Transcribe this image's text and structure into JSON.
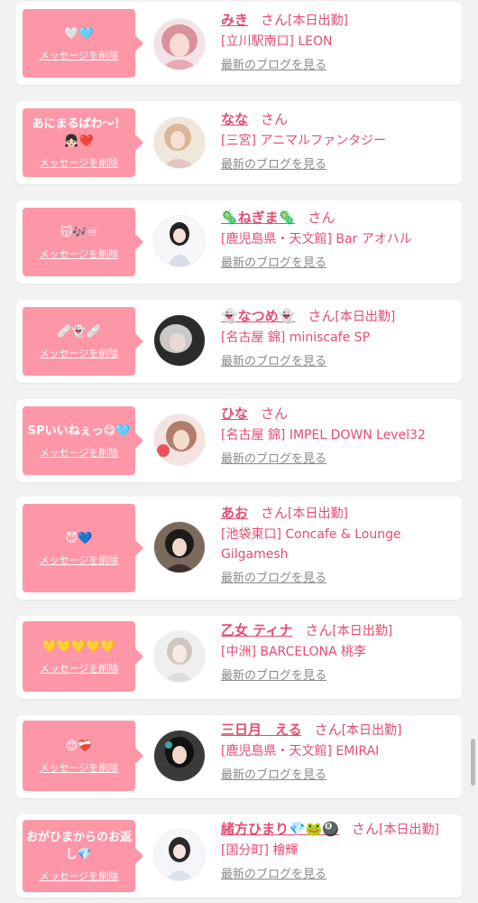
{
  "delete_label": "メッセージを削除",
  "san_label": "さん",
  "blog_label": "最新のブログを見る",
  "accent_color": "#fd97a7",
  "text_color": "#e54d73",
  "cards": [
    {
      "message": "🤍🩵",
      "name": "みき",
      "badge": "[本日出勤]",
      "shop": "[立川駅南口] LEON"
    },
    {
      "message": "あにまるぱわ～！👧🏻❤️",
      "name": "なな",
      "badge": "",
      "shop": "[三宮] アニマルファンタジー"
    },
    {
      "message": "😽🎶♾",
      "name": "🦠ねぎま🦠",
      "badge": "",
      "shop": "[鹿児島県・天文館] Bar アオハル"
    },
    {
      "message": "🩹👻🩹",
      "name": "👻なつめ👻",
      "badge": "[本日出勤]",
      "shop": "[名古屋 錦] miniscafe SP"
    },
    {
      "message": "SPいいねぇっ😋🩵",
      "name": "ひな",
      "badge": "",
      "shop": "[名古屋 錦] IMPEL DOWN Level32"
    },
    {
      "message": "😈💙",
      "name": "あお",
      "badge": "[本日出勤]",
      "shop": "[池袋東口] Concafe & Lounge Gilgamesh"
    },
    {
      "message": "💛💛💛💛💛",
      "name": "乙女 ティナ",
      "badge": "[本日出勤]",
      "shop": "[中洲] BARCELONA 桃李"
    },
    {
      "message": "😍❤️‍🩹",
      "name": "三日月　える",
      "badge": "[本日出勤]",
      "shop": "[鹿児島県・天文館] EMIRAI"
    },
    {
      "message": "おがひまからのお返し💎",
      "name": "緒方ひまり💎🐸🎱",
      "badge": "[本日出勤]",
      "shop": "[国分町] 檜輝"
    }
  ]
}
